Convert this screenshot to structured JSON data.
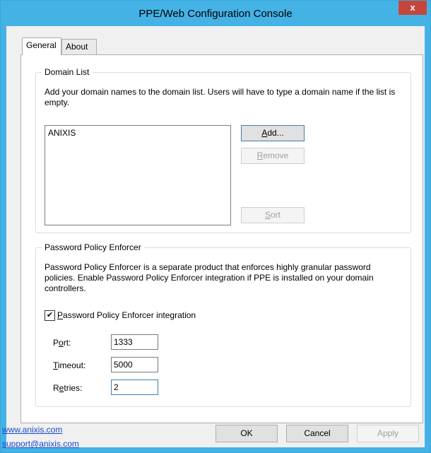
{
  "window": {
    "title": "PPE/Web Configuration Console",
    "close_glyph": "x"
  },
  "tabs": [
    {
      "label": "General"
    },
    {
      "label": "About"
    }
  ],
  "domain_list": {
    "legend": "Domain List",
    "description": "Add your domain names to the domain list. Users will have to type a domain name if the list is empty.",
    "items": [
      "ANIXIS"
    ],
    "buttons": {
      "add": "Add...",
      "remove": "Remove",
      "sort": "Sort"
    }
  },
  "ppe": {
    "legend": "Password Policy Enforcer",
    "description": "Password Policy Enforcer is a separate product that enforces highly granular password policies. Enable Password Policy Enforcer integration if PPE is installed on your domain controllers.",
    "integration_label": "Password Policy Enforcer integration",
    "integration_checked": true,
    "port_label": "Port:",
    "port_value": "1333",
    "timeout_label": "Timeout:",
    "timeout_value": "5000",
    "retries_label": "Retries:",
    "retries_value": "2"
  },
  "footer": {
    "website": "www.anixis.com",
    "support_email": "support@anixis.com",
    "ok": "OK",
    "cancel": "Cancel",
    "apply": "Apply"
  },
  "colors": {
    "titlebar": "#45b2e6",
    "close": "#c7463b",
    "link": "#1a4bd0"
  }
}
